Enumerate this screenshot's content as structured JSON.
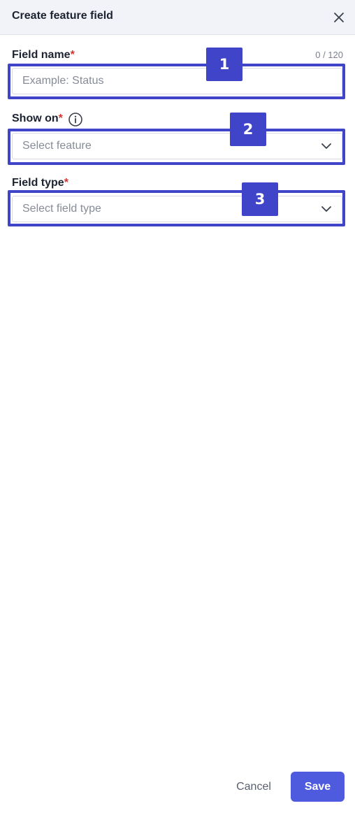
{
  "header": {
    "title": "Create feature field",
    "close_icon": "close-icon"
  },
  "fields": {
    "name": {
      "label": "Field name",
      "required_mark": "*",
      "counter": "0 / 120",
      "placeholder": "Example: Status",
      "value": ""
    },
    "show_on": {
      "label": "Show on",
      "required_mark": "*",
      "info_icon": "info-icon",
      "placeholder": "Select feature",
      "chevron_icon": "chevron-down-icon"
    },
    "type": {
      "label": "Field type",
      "required_mark": "*",
      "placeholder": "Select field type",
      "chevron_icon": "chevron-down-icon"
    }
  },
  "annotations": [
    {
      "number": "1"
    },
    {
      "number": "2"
    },
    {
      "number": "3"
    }
  ],
  "annotation_color": "#3f44c8",
  "footer": {
    "cancel_label": "Cancel",
    "save_label": "Save",
    "save_color": "#4e5bde"
  }
}
